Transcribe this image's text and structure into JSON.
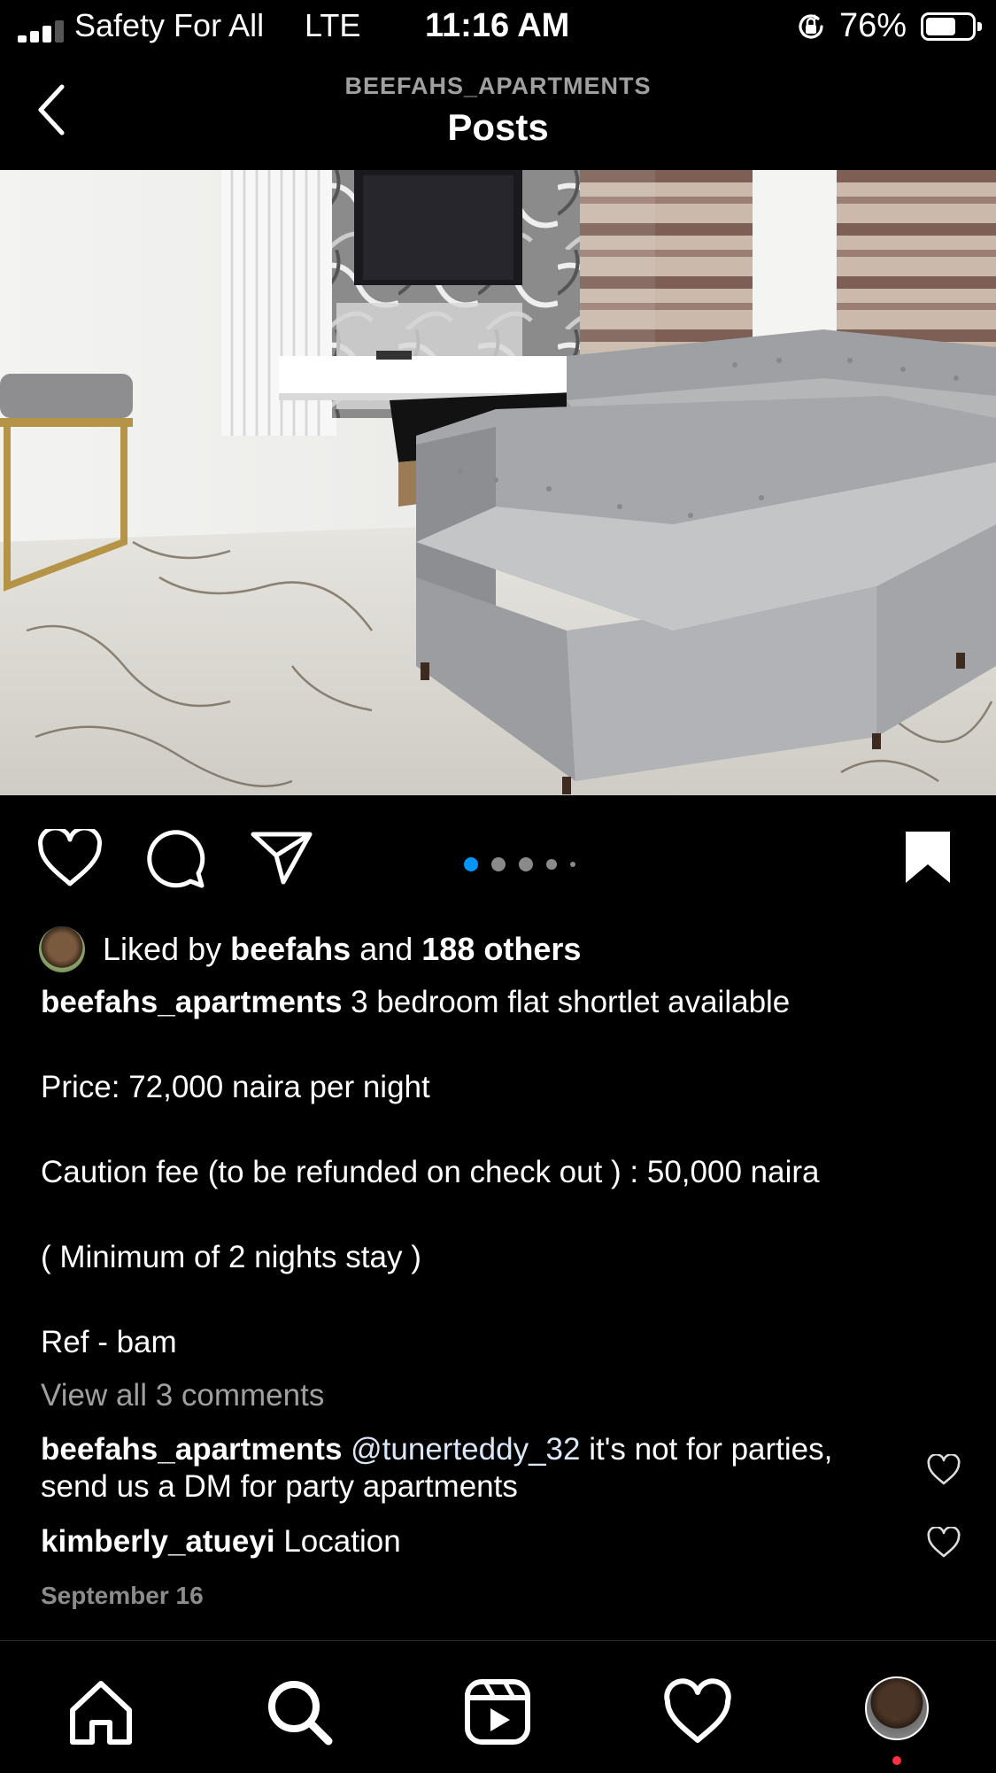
{
  "status_bar": {
    "carrier": "Safety For All",
    "network": "LTE",
    "time": "11:16 AM",
    "battery_percent": "76%",
    "battery_level": 0.76
  },
  "header": {
    "account_name": "BEEFAHS_APARTMENTS",
    "title": "Posts"
  },
  "post": {
    "carousel": {
      "total": 5,
      "active_index": 0,
      "accent_color": "#0095f6"
    },
    "likes": {
      "prefix": "Liked by",
      "user": "beefahs",
      "joiner": "and",
      "others": "188 others"
    },
    "caption": {
      "author": "beefahs_apartments",
      "first_line": "3 bedroom flat shortlet available",
      "lines": [
        "Price: 72,000 naira per night",
        "Caution fee (to be refunded on check out ) : 50,000 naira",
        "( Minimum of 2 nights stay )",
        "Ref - bam"
      ]
    },
    "view_comments_label": "View all 3 comments",
    "comments": [
      {
        "author": "beefahs_apartments",
        "mention": "@tunerteddy_32",
        "text": "it's not for parties, send us a DM for party apartments"
      },
      {
        "author": "kimberly_atueyi",
        "mention": "",
        "text": "Location"
      }
    ],
    "date": "September 16"
  },
  "icons": {
    "back": "chevron-left-icon",
    "like": "heart-icon",
    "comment": "speech-bubble-icon",
    "share": "paper-plane-icon",
    "save": "bookmark-filled-icon",
    "home": "home-icon",
    "search": "search-icon",
    "reels": "reels-icon",
    "activity": "heart-icon",
    "profile": "avatar"
  }
}
